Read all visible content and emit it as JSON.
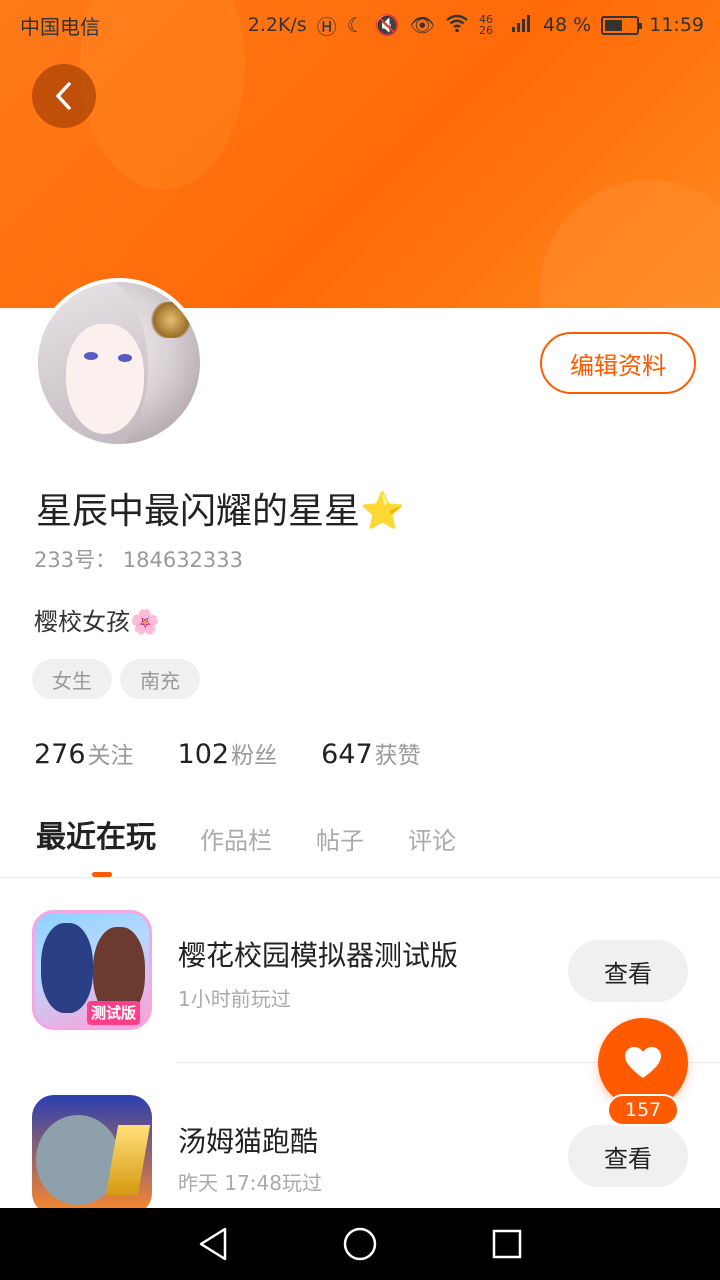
{
  "status_bar": {
    "carrier": "中国电信",
    "network_speed": "2.2K/s",
    "signal": "46 26",
    "battery": "48 %",
    "time": "11:59"
  },
  "profile": {
    "edit_label": "编辑资料",
    "nickname": "星辰中最闪耀的星星⭐",
    "uid": "233号： 184632333",
    "bio": "樱校女孩🌸",
    "tags": [
      "女生",
      "南充"
    ],
    "stats": [
      {
        "num": "276",
        "label": "关注"
      },
      {
        "num": "102",
        "label": "粉丝"
      },
      {
        "num": "647",
        "label": "获赞"
      }
    ]
  },
  "tabs": [
    "最近在玩",
    "作品栏",
    "帖子",
    "评论"
  ],
  "games": [
    {
      "title": "樱花校园模拟器测试版",
      "time": "1小时前玩过",
      "button": "查看",
      "badge": "测试版"
    },
    {
      "title": "汤姆猫跑酷",
      "time": "昨天 17:48玩过",
      "button": "查看"
    }
  ],
  "like": {
    "count": "157"
  },
  "colors": {
    "accent": "#ff5a00",
    "header": "#ff7a1a"
  },
  "icons": {
    "back": "chevron-left-icon",
    "like": "heart-icon",
    "nav": [
      "back-triangle-icon",
      "home-circle-icon",
      "recents-square-icon"
    ]
  }
}
